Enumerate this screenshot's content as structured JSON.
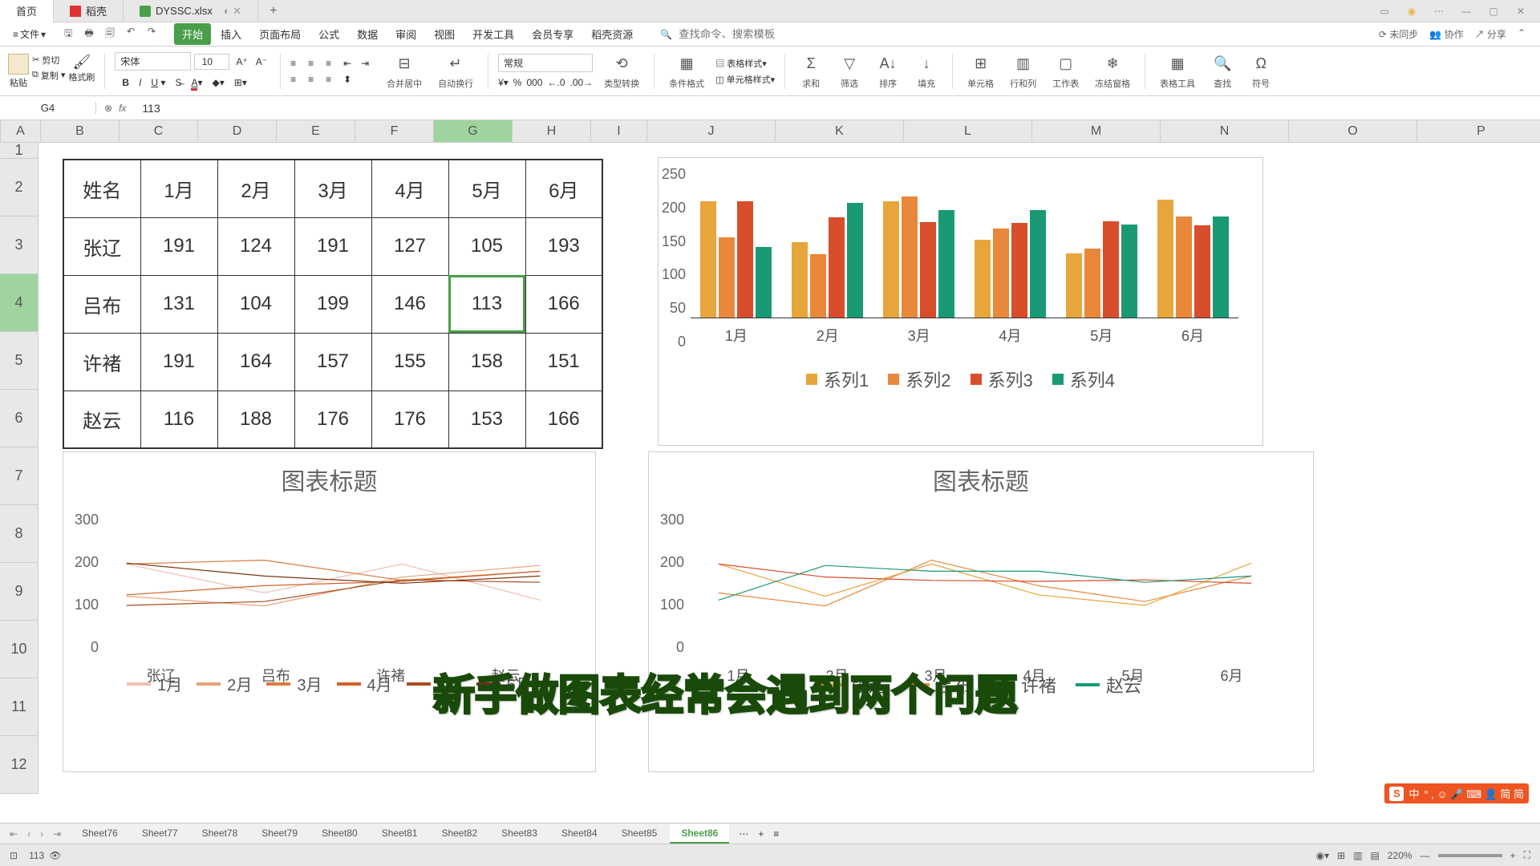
{
  "titlebar": {
    "home": "首页",
    "tabs": [
      "稻壳",
      "DYSSC.xlsx"
    ]
  },
  "menubar": {
    "file": "文件",
    "tabs": [
      "开始",
      "插入",
      "页面布局",
      "公式",
      "数据",
      "审阅",
      "视图",
      "开发工具",
      "会员专享",
      "稻壳资源"
    ],
    "search_hint": "查找命令、搜索模板",
    "right": [
      "未同步",
      "协作",
      "分享"
    ]
  },
  "ribbon": {
    "paste": "粘贴",
    "cut": "剪切",
    "copy": "复制",
    "fmtbrush": "格式刷",
    "font": "宋体",
    "size": "10",
    "mergecenter": "合并居中",
    "autowrap": "自动换行",
    "general": "常规",
    "typeconv": "类型转换",
    "condfmt": "条件格式",
    "tablestyle": "表格样式",
    "cellstyle": "单元格样式",
    "sum": "求和",
    "filter": "筛选",
    "sort": "排序",
    "fill": "填充",
    "cell": "单元格",
    "rowcol": "行和列",
    "worksheet": "工作表",
    "freeze": "冻结窗格",
    "tabletool": "表格工具",
    "find": "查找",
    "symbol": "符号"
  },
  "formulabar": {
    "cellref": "G4",
    "value": "113"
  },
  "columns": [
    "A",
    "B",
    "C",
    "D",
    "E",
    "F",
    "G",
    "H",
    "I",
    "J",
    "K",
    "L",
    "M",
    "N",
    "O",
    "P"
  ],
  "rows": [
    "1",
    "2",
    "3",
    "4",
    "5",
    "6",
    "7",
    "8",
    "9",
    "10",
    "11",
    "12"
  ],
  "selected_row": "4",
  "table": {
    "headers": [
      "姓名",
      "1月",
      "2月",
      "3月",
      "4月",
      "5月",
      "6月"
    ],
    "rows": [
      [
        "张辽",
        "191",
        "124",
        "191",
        "127",
        "105",
        "193"
      ],
      [
        "吕布",
        "131",
        "104",
        "199",
        "146",
        "113",
        "166"
      ],
      [
        "许褚",
        "191",
        "164",
        "157",
        "155",
        "158",
        "151"
      ],
      [
        "赵云",
        "116",
        "188",
        "176",
        "176",
        "153",
        "166"
      ]
    ],
    "selected": [
      1,
      5
    ]
  },
  "chart_data": [
    {
      "type": "bar",
      "categories": [
        "1月",
        "2月",
        "3月",
        "4月",
        "5月",
        "6月"
      ],
      "series": [
        {
          "name": "系列1",
          "values": [
            191,
            124,
            191,
            127,
            105,
            193
          ]
        },
        {
          "name": "系列2",
          "values": [
            131,
            104,
            199,
            146,
            113,
            166
          ]
        },
        {
          "name": "系列3",
          "values": [
            191,
            164,
            157,
            155,
            158,
            151
          ]
        },
        {
          "name": "系列4",
          "values": [
            116,
            188,
            176,
            176,
            153,
            166
          ]
        }
      ],
      "ylim": [
        0,
        250
      ],
      "yticks": [
        0,
        50,
        100,
        150,
        200,
        250
      ],
      "colors": [
        "#e6a63c",
        "#e9873a",
        "#d84d2b",
        "#1a9975"
      ]
    },
    {
      "type": "line",
      "title": "图表标题",
      "categories": [
        "张辽",
        "吕布",
        "许褚",
        "赵云"
      ],
      "series": [
        {
          "name": "1月",
          "values": [
            191,
            131,
            191,
            116
          ]
        },
        {
          "name": "2月",
          "values": [
            124,
            104,
            164,
            188
          ]
        },
        {
          "name": "3月",
          "values": [
            191,
            199,
            157,
            176
          ]
        },
        {
          "name": "4月",
          "values": [
            127,
            146,
            155,
            176
          ]
        },
        {
          "name": "5月",
          "values": [
            105,
            113,
            158,
            153
          ]
        },
        {
          "name": "6月",
          "values": [
            193,
            166,
            151,
            166
          ]
        }
      ],
      "ylim": [
        0,
        300
      ],
      "yticks": [
        0,
        100,
        200,
        300
      ]
    },
    {
      "type": "line",
      "title": "图表标题",
      "categories": [
        "1月",
        "2月",
        "3月",
        "4月",
        "5月",
        "6月"
      ],
      "series": [
        {
          "name": "张辽",
          "values": [
            191,
            124,
            191,
            127,
            105,
            193
          ]
        },
        {
          "name": "吕布",
          "values": [
            131,
            104,
            199,
            146,
            113,
            166
          ]
        },
        {
          "name": "许褚",
          "values": [
            191,
            164,
            157,
            155,
            158,
            151
          ]
        },
        {
          "name": "赵云",
          "values": [
            116,
            188,
            176,
            176,
            153,
            166
          ]
        }
      ],
      "ylim": [
        0,
        300
      ],
      "yticks": [
        0,
        100,
        200,
        300
      ]
    }
  ],
  "sheets": [
    "Sheet76",
    "Sheet77",
    "Sheet78",
    "Sheet79",
    "Sheet80",
    "Sheet81",
    "Sheet82",
    "Sheet83",
    "Sheet84",
    "Sheet85",
    "Sheet86"
  ],
  "active_sheet": "Sheet86",
  "statusbar": {
    "left": "113",
    "zoom": "220%"
  },
  "caption": "新手做图表经常会遇到两个问题",
  "ime": {
    "lang": "中",
    "label": "简 简"
  }
}
